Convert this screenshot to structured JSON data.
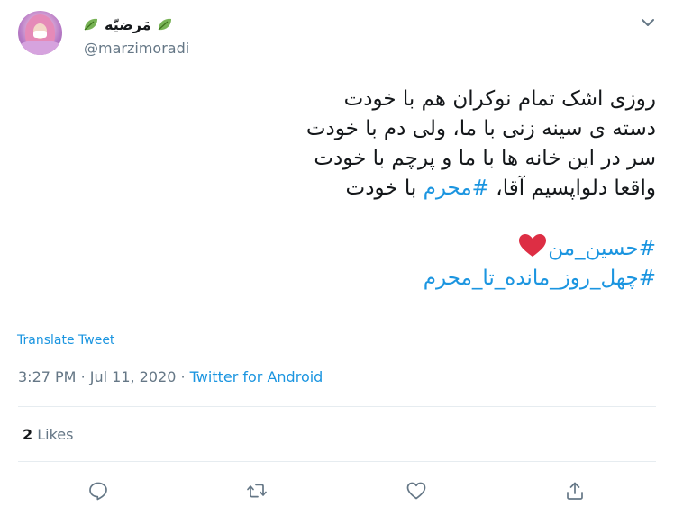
{
  "author": {
    "display_name": "مَرضیّه",
    "handle": "@marzimoradi"
  },
  "tweet": {
    "lines": [
      "روزی اشک تمام نوکران هم با خودت",
      "دسته ی سینه زنی با ما، ولی دم با خودت",
      "سر در این خانه ها با ما و پرچم با خودت"
    ],
    "line4_prefix": "واقعا دلواپسیم آقا، ",
    "line4_hashtag": "#محرم",
    "line4_suffix": " با خودت",
    "hashtag_1": "#حسین_من",
    "hashtag_2": "#چهل_روز_مانده_تا_محرم",
    "emoji": "red-heart"
  },
  "translate_label": "Translate Tweet",
  "meta": {
    "time": "3:27 PM",
    "separator": "·",
    "date": "Jul 11, 2020",
    "source": "Twitter for Android"
  },
  "stats": {
    "likes_count": "2",
    "likes_label": "Likes"
  },
  "colors": {
    "link": "#1b95e0",
    "text": "#14171a",
    "secondary": "#657786",
    "divider": "#e6ecf0",
    "heart": "#e0245e"
  },
  "icons": [
    "leaf-icon",
    "chevron-down-icon",
    "reply-icon",
    "retweet-icon",
    "like-icon",
    "share-icon"
  ]
}
